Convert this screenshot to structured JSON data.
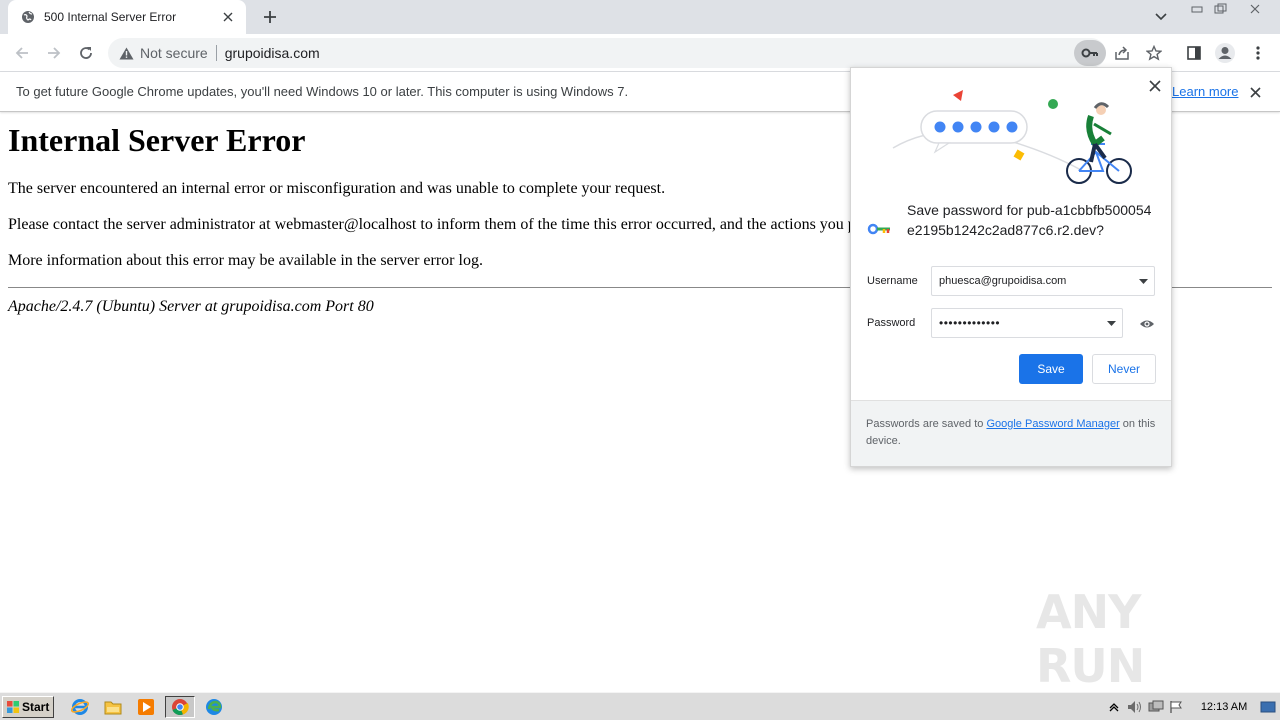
{
  "browser": {
    "tab": {
      "title": "500 Internal Server Error",
      "favicon": "globe-icon"
    },
    "address": {
      "security_label": "Not secure",
      "url": "grupoidisa.com"
    },
    "infobar": {
      "message": "To get future Google Chrome updates, you'll need Windows 10 or later. This computer is using Windows 7.",
      "link": "Learn more"
    }
  },
  "page": {
    "heading": "Internal Server Error",
    "paragraphs": [
      "The server encountered an internal error or misconfiguration and was unable to complete your request.",
      "Please contact the server administrator at webmaster@localhost to inform them of the time this error occurred, and the actions you performe",
      "More information about this error may be available in the server error log."
    ],
    "signature": "Apache/2.4.7 (Ubuntu) Server at grupoidisa.com Port 80"
  },
  "password_bubble": {
    "title": "Save password for pub-a1cbbfb500054e2195b1242c2ad877c6.r2.dev?",
    "username_label": "Username",
    "username_value": "phuesca@grupoidisa.com",
    "password_label": "Password",
    "password_value": "•••••••••••••",
    "save_label": "Save",
    "never_label": "Never",
    "footer_prefix": "Passwords are saved to ",
    "footer_link": "Google Password Manager",
    "footer_suffix": " on this device."
  },
  "taskbar": {
    "start_label": "Start",
    "clock": "12:13 AM"
  },
  "watermark": "ANY RUN",
  "colors": {
    "accent": "#1a73e8",
    "tabstrip": "#dee1e6",
    "omnibox": "#f1f3f4"
  }
}
